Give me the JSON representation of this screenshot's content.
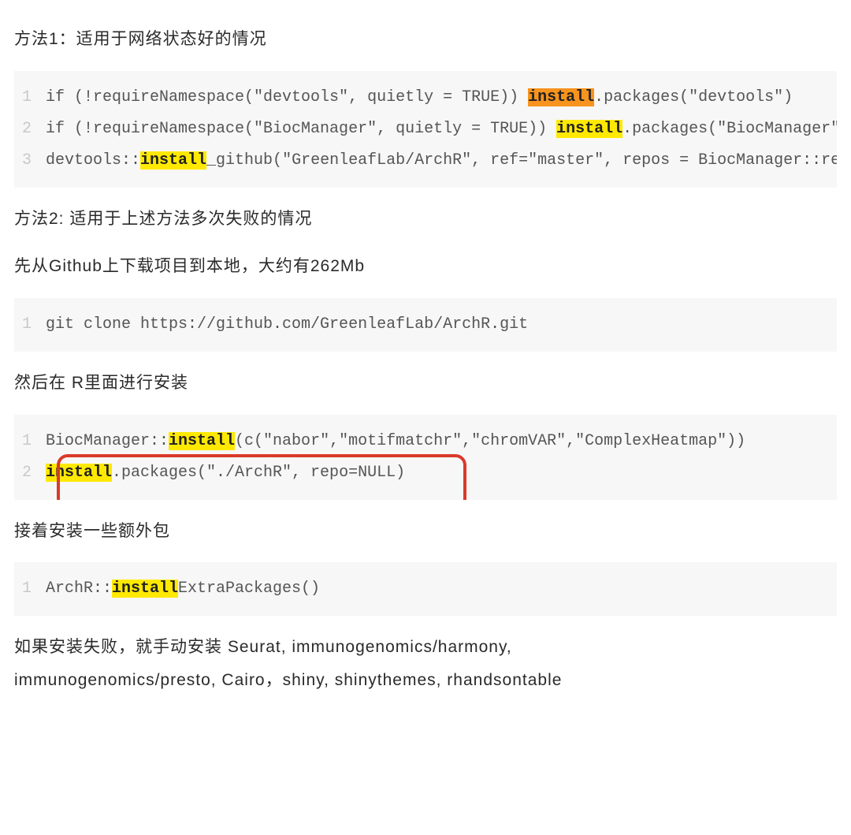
{
  "para1": "方法1：适用于网络状态好的情况",
  "code1": {
    "line1_a": "if (!requireNamespace(\"devtools\", quietly = TRUE)) ",
    "line1_hl": "install",
    "line1_b": ".packages(\"devtools\")",
    "line2_a": "if (!requireNamespace(\"BiocManager\", quietly = TRUE)) ",
    "line2_hl": "install",
    "line2_b": ".packages(\"BiocManager\")",
    "line3_a": "devtools::",
    "line3_hl": "install",
    "line3_b": "_github(\"GreenleafLab/ArchR\", ref=\"master\", repos = BiocManager::repositories())"
  },
  "para2": "方法2:  适用于上述方法多次失败的情况",
  "para3": "先从Github上下载项目到本地，大约有262Mb",
  "code2": {
    "line1": "git clone https://github.com/GreenleafLab/ArchR.git"
  },
  "para4": "然后在  R里面进行安装",
  "code3": {
    "line1_a": "BiocManager::",
    "line1_hl": "install",
    "line1_b": "(c(\"nabor\",\"motifmatchr\",\"chromVAR\",\"ComplexHeatmap\"))",
    "line2_hl": "install",
    "line2_a": ".packages(\"./ArchR\", repo=NULL)"
  },
  "para5": "接着安装一些额外包",
  "code4": {
    "line1_a": "ArchR::",
    "line1_hl": "install",
    "line1_b": "ExtraPackages()"
  },
  "para6a": "如果安装失败，就手动安装 Seurat, immunogenomics/harmony,",
  "para6b": " immunogenomics/presto,   Cairo，shiny, shinythemes, rhandsontable",
  "linenos": {
    "n1": "1",
    "n2": "2",
    "n3": "3"
  }
}
